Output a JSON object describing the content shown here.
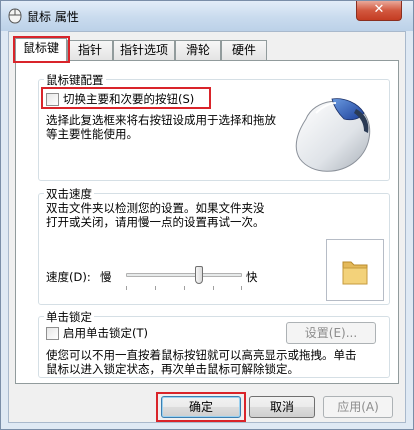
{
  "window": {
    "title": "鼠标 属性",
    "close_label": "✕"
  },
  "tabs": [
    {
      "label": "鼠标键"
    },
    {
      "label": "指针"
    },
    {
      "label": "指针选项"
    },
    {
      "label": "滑轮"
    },
    {
      "label": "硬件"
    }
  ],
  "button_config": {
    "legend": "鼠标键配置",
    "switch_checkbox_label": "切换主要和次要的按钮(S)",
    "description_line1": "选择此复选框来将右按钮设成用于选择和拖放",
    "description_line2": "等主要性能使用。"
  },
  "double_click": {
    "legend": "双击速度",
    "description_line1": "双击文件夹以检测您的设置。如果文件夹没",
    "description_line2": "打开或关闭，请用慢一点的设置再试一次。",
    "speed_label": "速度(D):",
    "slow_label": "慢",
    "fast_label": "快",
    "speed_value_fraction": 0.63
  },
  "click_lock": {
    "legend": "单击锁定",
    "checkbox_label": "启用单击锁定(T)",
    "settings_button": "设置(E)...",
    "description_line1": "使您可以不用一直按着鼠标按钮就可以高亮显示或拖拽。单击",
    "description_line2": "鼠标以进入锁定状态，再次单击鼠标可解除锁定。"
  },
  "footer": {
    "ok_label": "确定",
    "cancel_label": "取消",
    "apply_label": "应用(A)"
  },
  "colors": {
    "highlight_red": "#d9242a",
    "folder_yellow": "#f3d27a"
  }
}
